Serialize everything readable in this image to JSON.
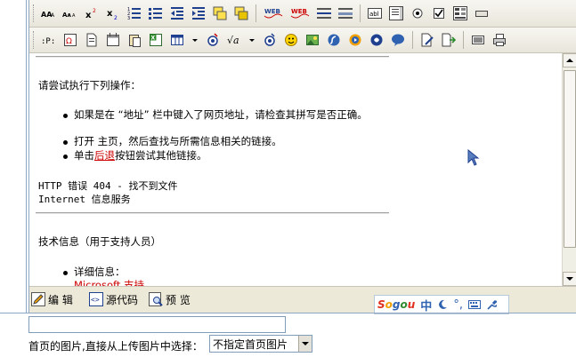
{
  "editor": {
    "try_heading": "请尝试执行下列操作：",
    "bullets": [
      "如果是在 “地址” 栏中键入了网页地址，请检查其拼写是否正确。",
      "打开 主页，然后查找与所需信息相关的链接。"
    ],
    "back_prefix": "单击",
    "back_link": "后退",
    "back_suffix": "按钮尝试其他链接。",
    "error_line": "HTTP 错误 404 - 找不到文件",
    "service_line": "Internet 信息服务",
    "tech_heading": "技术信息（用于支持人员）",
    "details_label": "详细信息：",
    "cut_text": "Microsoft 支持"
  },
  "mode_tabs": {
    "edit": "编  辑",
    "source": "源代码",
    "preview": "预  览"
  },
  "ime": {
    "brand": "Sogou",
    "mode_char": "中",
    "punct": "°,"
  },
  "form": {
    "input_value": "",
    "image_label": "首页的图片,直接从上传图片中选择：",
    "image_select_value": "不指定首页图片"
  },
  "colors": {
    "link_red": "#cc0000",
    "toolbar_bg": "#ece9d8",
    "frame_blue": "#8fa6c2"
  }
}
